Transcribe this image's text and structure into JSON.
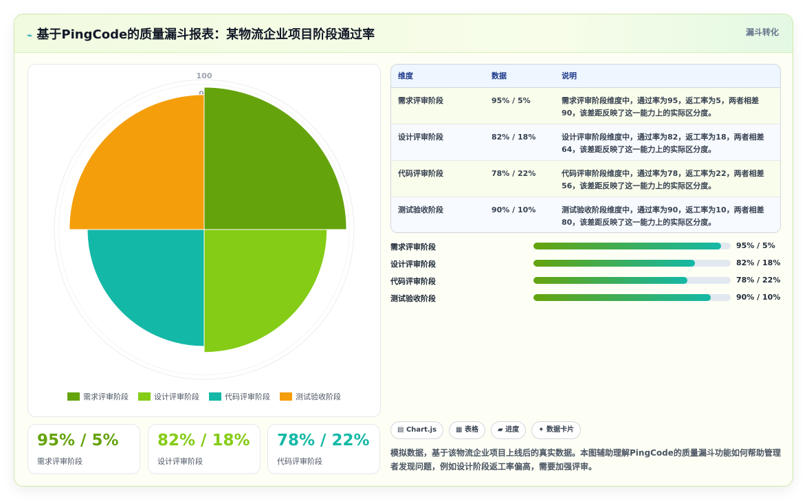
{
  "header": {
    "title_icon": "⌁",
    "title": "基于PingCode的质量漏斗报表：某物流企业项目阶段通过率",
    "tag": "漏斗转化"
  },
  "chart_data": {
    "type": "polarArea",
    "categories": [
      "需求评审阶段",
      "设计评审阶段",
      "代码评审阶段",
      "测试验收阶段"
    ],
    "values": [
      95,
      82,
      78,
      90
    ],
    "colors": [
      "#65a30d",
      "#84cc16",
      "#14b8a6",
      "#f59e0b"
    ],
    "rlim": [
      0,
      100
    ],
    "r_tick_labels": [
      "100",
      "0"
    ],
    "legend": "bottom"
  },
  "kpis": [
    {
      "value": "95% / 5%",
      "label": "需求评审阶段",
      "color": "#65a30d"
    },
    {
      "value": "82% / 18%",
      "label": "设计评审阶段",
      "color": "#84cc16"
    },
    {
      "value": "78% / 22%",
      "label": "代码评审阶段",
      "color": "#14b8a6"
    }
  ],
  "table": {
    "headers": [
      "维度",
      "数据",
      "说明"
    ],
    "rows": [
      [
        "需求评审阶段",
        "95% / 5%",
        "需求评审阶段维度中，通过率为95，返工率为5，两者相差90，该差距反映了这一能力上的实际区分度。"
      ],
      [
        "设计评审阶段",
        "82% / 18%",
        "设计评审阶段维度中，通过率为82，返工率为18，两者相差64，该差距反映了这一能力上的实际区分度。"
      ],
      [
        "代码评审阶段",
        "78% / 22%",
        "代码评审阶段维度中，通过率为78，返工率为22，两者相差56，该差距反映了这一能力上的实际区分度。"
      ],
      [
        "测试验收阶段",
        "90% / 10%",
        "测试验收阶段维度中，通过率为90，返工率为10，两者相差80，该差距反映了这一能力上的实际区分度。"
      ]
    ]
  },
  "progress": [
    {
      "label": "需求评审阶段",
      "fraction": 0.95,
      "value": "95% / 5%"
    },
    {
      "label": "设计评审阶段",
      "fraction": 0.82,
      "value": "82% / 18%"
    },
    {
      "label": "代码评审阶段",
      "fraction": 0.78,
      "value": "78% / 22%"
    },
    {
      "label": "测试验收阶段",
      "fraction": 0.9,
      "value": "90% / 10%"
    }
  ],
  "chips": [
    {
      "icon": "▤",
      "label": "Chart.js"
    },
    {
      "icon": "▦",
      "label": "表格"
    },
    {
      "icon": "▰",
      "label": "进度"
    },
    {
      "icon": "✦",
      "label": "数据卡片"
    }
  ],
  "note": "模拟数据，基于该物流企业项目上线后的真实数据。本图辅助理解PingCode的质量漏斗功能如何帮助管理者发现问题，例如设计阶段返工率偏高，需要加强评审。"
}
